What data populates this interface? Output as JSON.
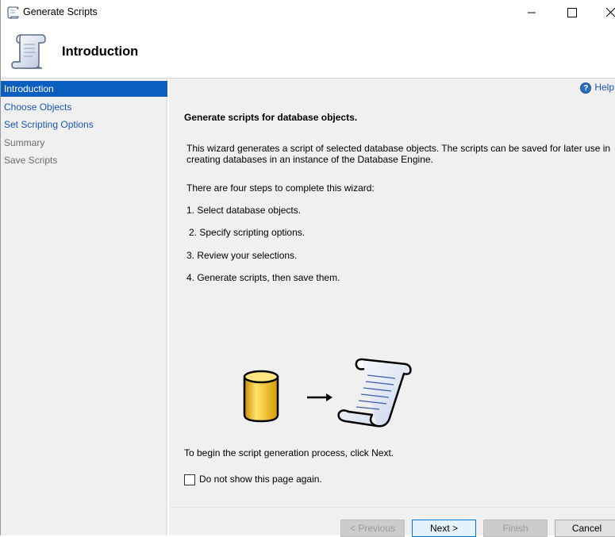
{
  "window": {
    "title": "Generate Scripts",
    "icons": {
      "app": "scroll-icon",
      "minimize": "minimize-icon",
      "maximize": "maximize-icon",
      "close": "close-icon"
    }
  },
  "header": {
    "title": "Introduction",
    "icon": "script-scroll-icon"
  },
  "sidebar": {
    "items": [
      {
        "label": "Introduction",
        "state": "active"
      },
      {
        "label": "Choose Objects",
        "state": "link"
      },
      {
        "label": "Set Scripting Options",
        "state": "link"
      },
      {
        "label": "Summary",
        "state": "disabled"
      },
      {
        "label": "Save Scripts",
        "state": "disabled"
      }
    ],
    "active_color": "#0a5fbe"
  },
  "main": {
    "help_label": "Help",
    "heading": "Generate scripts for database objects.",
    "description": "This wizard generates a script of selected database objects. The scripts can be saved for later use in creating databases in an instance of the Database Engine.",
    "steps_intro": "There are four steps to complete this wizard:",
    "steps": [
      "1. Select database objects.",
      "2. Specify scripting options.",
      "3. Review your selections.",
      "4. Generate scripts, then save them."
    ],
    "illustration": {
      "left": "database-cylinder-icon",
      "middle": "arrow-right-icon",
      "right": "script-scroll-icon"
    },
    "begin_text": "To begin the script generation process, click Next.",
    "checkbox": {
      "label": "Do not show this page again.",
      "checked": false
    }
  },
  "footer": {
    "previous": "< Previous",
    "next": "Next >",
    "finish": "Finish",
    "cancel": "Cancel"
  }
}
